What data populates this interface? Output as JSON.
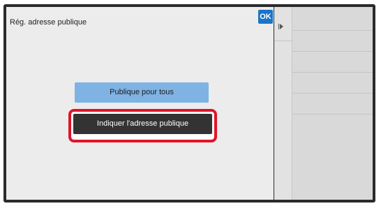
{
  "dialog": {
    "title": "Rég. adresse publique",
    "ok_label": "OK"
  },
  "options": {
    "public_all_label": "Publique pour tous",
    "indicate_address_label": "Indiquer l'adresse publique"
  },
  "side_panel": {
    "icon": "play-pause-icon",
    "row_count": 5
  },
  "colors": {
    "ok_button": "#1a74c9",
    "option_light": "#7fb3e4",
    "option_selected": "#333333",
    "highlight": "#e0142a"
  }
}
